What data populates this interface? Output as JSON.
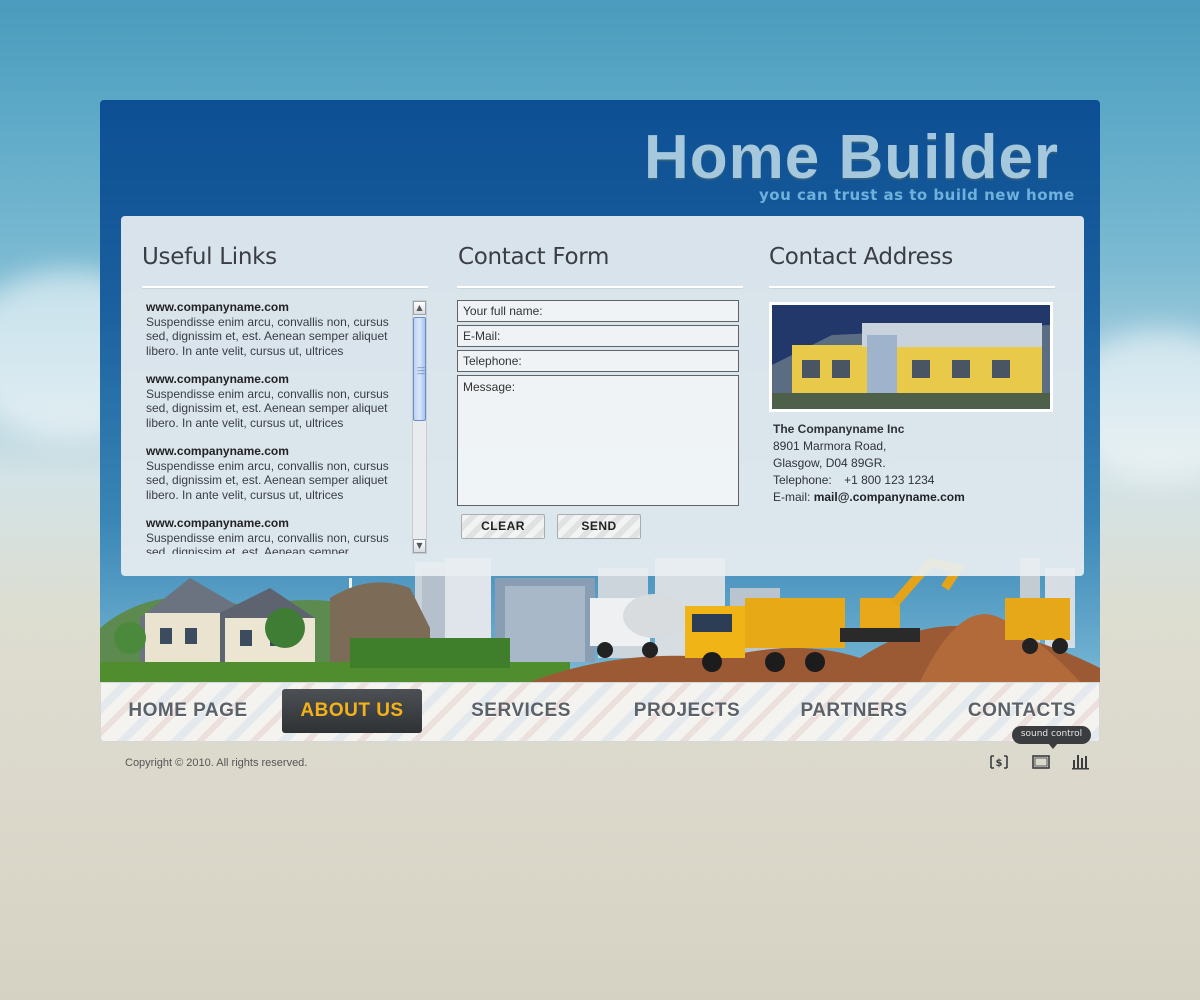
{
  "header": {
    "title": "Home Builder",
    "tagline": "you can trust as to build new home"
  },
  "links": {
    "title": "Useful Links",
    "items": [
      {
        "url": "www.companyname.com",
        "text": "Suspendisse enim arcu, convallis non, cursus sed, dignissim et, est. Aenean semper aliquet libero. In ante velit, cursus ut, ultrices"
      },
      {
        "url": "www.companyname.com",
        "text": "Suspendisse enim arcu, convallis non, cursus sed, dignissim et, est. Aenean semper aliquet libero. In ante velit, cursus ut, ultrices"
      },
      {
        "url": "www.companyname.com",
        "text": "Suspendisse enim arcu, convallis non, cursus sed, dignissim et, est. Aenean semper aliquet libero. In ante velit, cursus ut, ultrices"
      },
      {
        "url": "www.companyname.com",
        "text": "Suspendisse enim arcu, convallis non, cursus sed, dignissim et, est. Aenean semper"
      }
    ]
  },
  "form": {
    "title": "Contact Form",
    "name_placeholder": "Your full name:",
    "email_placeholder": "E-Mail:",
    "phone_placeholder": "Telephone:",
    "message_placeholder": "Message:",
    "clear_label": "CLEAR",
    "send_label": "SEND"
  },
  "address": {
    "title": "Contact Address",
    "company": "The Companyname Inc",
    "street": "8901 Marmora Road,",
    "city": "Glasgow, D04 89GR.",
    "phone_label": "Telephone:",
    "phone": "+1 800 123 1234",
    "email_label": "E-mail:",
    "email": "mail@.companyname.com"
  },
  "nav": {
    "items": [
      "HOME PAGE",
      "ABOUT US",
      "SERVICES",
      "PROJECTS",
      "PARTNERS",
      "CONTACTS"
    ],
    "active": "ABOUT US"
  },
  "footer": {
    "sound_control": "sound control",
    "copyright": "Copyright © 2010. All rights reserved.",
    "icons": [
      "dollar-icon",
      "fullscreen-icon",
      "equalizer-icon"
    ]
  },
  "colors": {
    "header_blue": "#0d4f93",
    "nav_active_bg": "#333538",
    "nav_active_text": "#f3b21a",
    "title_text": "#a6c8dc"
  }
}
